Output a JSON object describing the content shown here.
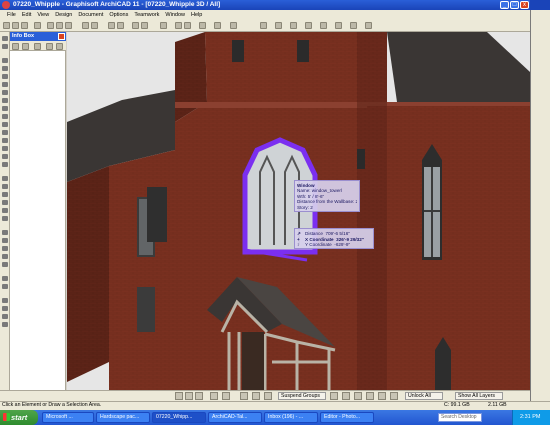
{
  "window": {
    "title": "07220_Whipple - Graphisoft ArchiCAD 11 - [07220_Whipple 3D / All]",
    "minimize_glyph": "_",
    "maximize_glyph": "□",
    "close_glyph": "x"
  },
  "menu": [
    "File",
    "Edit",
    "View",
    "Design",
    "Document",
    "Options",
    "Teamwork",
    "Window",
    "Help"
  ],
  "infobox": {
    "title": "Info Box"
  },
  "tracker": {
    "title": "Window",
    "lines": [
      "Name: window_towerl",
      "Wth: 5' / 8'-6\"",
      "Distance from the Wallbase: 2'",
      "Story: 2"
    ],
    "coords": [
      {
        "symbol": "↗",
        "label": "Distance",
        "value": "709'-6 5/16\""
      },
      {
        "symbol": "+",
        "label": "X Coordinate",
        "value": "326'-9 29/32\""
      },
      {
        "symbol": "↕",
        "label": "Y Coordinate",
        "value": "-629'-9\""
      }
    ]
  },
  "bottom_controls": {
    "suspend_groups": "Suspend Groups",
    "unlock_all": "Unlock All",
    "show_all_layers": "Show All Layers"
  },
  "status": {
    "message": "Click an Element or Draw a Selection Area.",
    "storage": "C: 99.1 GB",
    "memory": "2.11 GB"
  },
  "taskbar": {
    "start": "start",
    "tasks": [
      "Microsoft ...",
      "Hardscape pac...",
      "07220_Whipp...",
      "ArchiCAD-Tal...",
      "Inbox (196) - ...",
      "Editor - Photo..."
    ],
    "search_placeholder": "Search Desktop",
    "clock": "2:31 PM"
  },
  "colors": {
    "brick": "#7a3020",
    "brick_dark": "#5e2418",
    "roof": "#3a3634",
    "selection": "#7b2ff0",
    "sky": "#e6e6e6"
  }
}
